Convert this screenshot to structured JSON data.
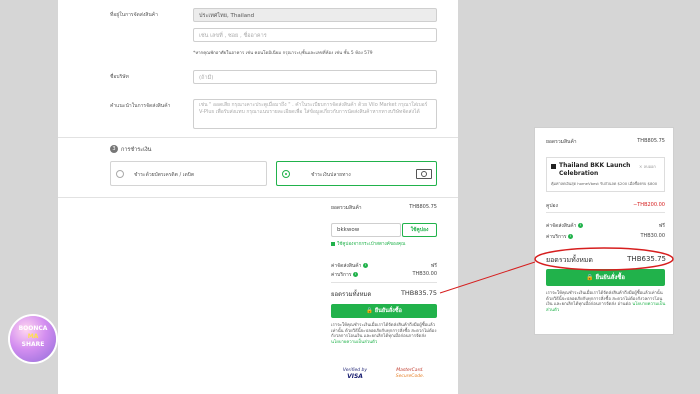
{
  "address": {
    "label": "ที่อยู่ในการจัดส่งสินค้า",
    "country_value": "ประเทศไทย, Thailand",
    "line_placeholder": "เช่น เลขที่ , ซอย , ชื่ออาคาร",
    "hint": "*หากคุณพักอาศัยในอาคาร เช่น คอนโดมิเนียม กรุณาระบุชั้นและเลขที่ห้อง เช่น ชั้น 5 ห้อง 579"
  },
  "company": {
    "label": "ชื่อบริษัท",
    "placeholder": "(ถ้ามี)"
  },
  "delivery_note": {
    "label": "คำแนะนำในการจัดส่งสินค้า",
    "placeholder": "เช่น \" ออดเสีย กรุณาเคาะประตูเมื่อมาถึง \" . คำในระเบียบการจัดส่งสินค้า ด้วย Vilo Market กรุณาใส่เบอร์ V-Plus เพื่อรับส่งแทบ กรุณาแนบรายละเอียดเพื่อ ใส่ข้อมูลเกี่ยวกับการนัดส่งสินค้าหากทางบริษัทจัดส่งได้"
  },
  "payment": {
    "step": "3",
    "title": "การชำระเงิน",
    "option_card": "ชำระด้วยบัตรเครดิต / เดบิต",
    "option_bank": "ชำระเงินปลายทาง"
  },
  "summary": {
    "subtotal_label": "ยอดรวมสินค้า",
    "subtotal_value": "THB805.75",
    "coupon_value": "bkkwow",
    "coupon_button": "ใช้คูปอง",
    "coupon_link": "ใช้คูปองจากกระเป๋าสตางค์ของคุณ",
    "shipping_label": "ค่าจัดส่งสินค้า",
    "shipping_value": "ฟรี",
    "service_label": "ค่าบริการ",
    "service_value": "THB30.00",
    "total_label": "ยอดรวมทั้งหมด",
    "total_value": "THB835.75",
    "confirm_button": "ยืนยันสั่งซื้อ",
    "terms": "เราจะให้คุณชำระเงินเมื่อเราได้จัดส่งสินค้าถึงมือผู้ซื้อแล้วเท่านั้น ด้วยวิธีนี้จะปลอดภัยกับทุกการสั่งซื้อ สะดวกไม่ต้องกังวลการโอนเงิน และยกเลิกได้ทุกเมื่อก่อนการจัดส่ง",
    "terms_link": "นโยบายความเป็นส่วนตัว",
    "verified_visa_line1": "Verified by",
    "verified_visa_line2": "VISA",
    "mastercard_line1": "MasterCard.",
    "mastercard_line2": "SecureCode."
  },
  "zoom": {
    "subtotal_label": "ยอดรวมสินค้า",
    "subtotal_value": "THB805.75",
    "promo_title": "Thailand BKK Launch Celebration",
    "promo_remove": "× ลบออก",
    "promo_desc": "คุ้มค่าลดเงินสุด homeVbest รับส่วนลด $200 เมื่อซื้อครบ $800",
    "coupon_label": "คูปอง",
    "coupon_value": "−THB200.00",
    "shipping_label": "ค่าจัดส่งสินค้า",
    "shipping_value": "ฟรี",
    "service_label": "ค่าบริการ",
    "service_value": "THB30.00",
    "total_label": "ยอดรวมทั้งหมด",
    "total_value": "THB635.75",
    "confirm_button": "ยืนยันสั่งซื้อ",
    "terms": "เราจะให้คุณชำระเงินเมื่อเราได้จัดส่งสินค้าถึงมือผู้ซื้อแล้วเท่านั้น ด้วยวิธีนี้จะปลอดภัยกับทุกการสั่งซื้อ สะดวกไม่ต้องกังวลการโอนเงิน และยกเลิกได้ทุกเมื่อก่อนการจัดส่ง อ่านต่อ",
    "terms_link": "นโยบายความเป็นส่วนตัว"
  },
  "logo": {
    "line1": "BOONCA",
    "line2": "MA",
    "line3": "SHARE"
  },
  "colors": {
    "accent": "#21b24b",
    "highlight": "#d61e1e",
    "background": "#d6d6d6"
  }
}
